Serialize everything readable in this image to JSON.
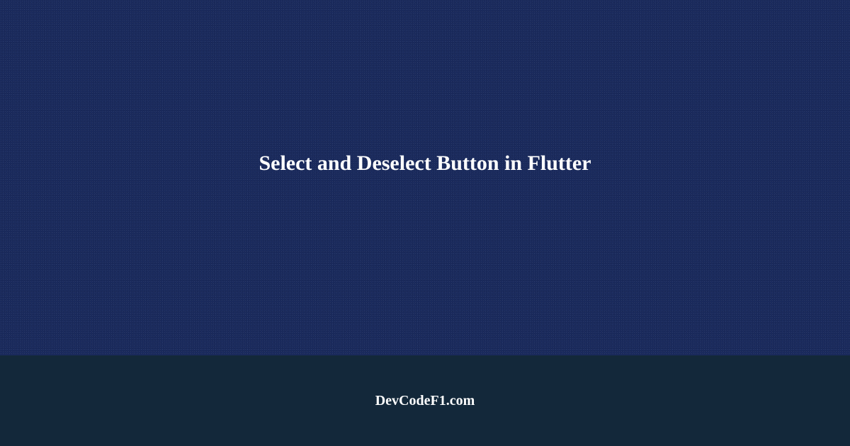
{
  "main": {
    "title": "Select and Deselect Button in Flutter"
  },
  "footer": {
    "site_name": "DevCodeF1.com"
  }
}
